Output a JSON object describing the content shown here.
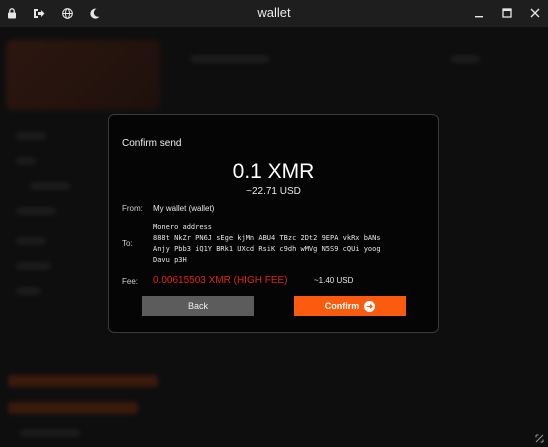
{
  "window": {
    "title": "wallet"
  },
  "titlebar": {
    "icons": [
      "lock-icon",
      "logout-icon",
      "globe-icon",
      "moon-icon"
    ],
    "controls": [
      "minimize-icon",
      "maximize-icon",
      "close-icon"
    ]
  },
  "dialog": {
    "title": "Confirm send",
    "amount": "0.1 XMR",
    "amount_usd": "~22.71 USD",
    "from_label": "From:",
    "from_value": "My wallet (wallet)",
    "to_label": "To:",
    "address_title": "Monero address",
    "address_lines": [
      "888t NkZr PN6J sEge kjMn ABU4 TBzc 2Dt2 9EPA vkRx bANs",
      "Anjy Pbb3 iQ1Y BRk1 UXcd RsiK c9dh wMVg N5S9 cQUi yoog",
      "Davu p3H"
    ],
    "fee_label": "Fee:",
    "fee_xmr": "0.00615503 XMR (HIGH FEE)",
    "fee_usd": "~1.40 USD",
    "back_label": "Back",
    "confirm_label": "Confirm"
  },
  "colors": {
    "accent": "#fa5b0f",
    "fee_warning": "#e0241b",
    "dialog_bg": "#050505",
    "back_button": "#5c5c5c"
  }
}
